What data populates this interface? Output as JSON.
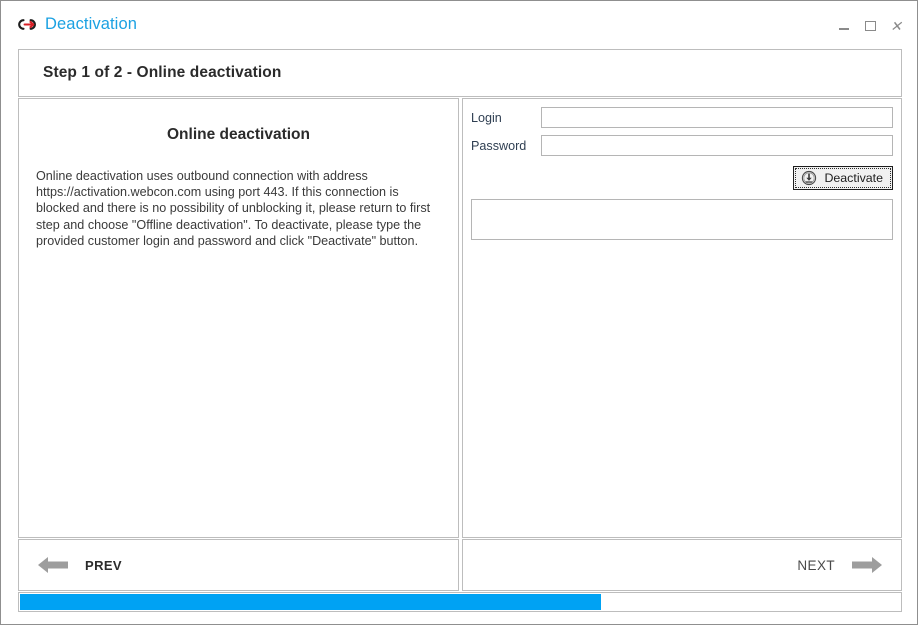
{
  "window": {
    "title": "Deactivation",
    "icon": "broken-link-icon",
    "accent_color": "#1ba1e2",
    "controls": {
      "minimize": "minimize-icon",
      "maximize": "maximize-icon",
      "close": "close-icon"
    }
  },
  "header": {
    "step_title": "Step 1 of 2 - Online deactivation"
  },
  "left_panel": {
    "heading": "Online deactivation",
    "paragraph": "Online deactivation uses outbound connection with address https://activation.webcon.com using port 443. If this connection is blocked and there is no possibility of unblocking it, please return to first step and choose \"Offline deactivation\". To deactivate, please type the provided customer login and password and click \"Deactivate\" button."
  },
  "right_panel": {
    "fields": [
      {
        "label": "Login",
        "value": "",
        "placeholder": ""
      },
      {
        "label": "Password",
        "value": "",
        "placeholder": ""
      }
    ],
    "deactivate_button": {
      "label": "Deactivate",
      "icon": "download-circle-icon"
    },
    "status_message": ""
  },
  "footer": {
    "prev_label": "PREV",
    "next_label": "NEXT",
    "prev_icon": "arrow-left-icon",
    "next_icon": "arrow-right-icon"
  },
  "progress": {
    "percent": 66,
    "fill_color": "#00a2f3"
  }
}
